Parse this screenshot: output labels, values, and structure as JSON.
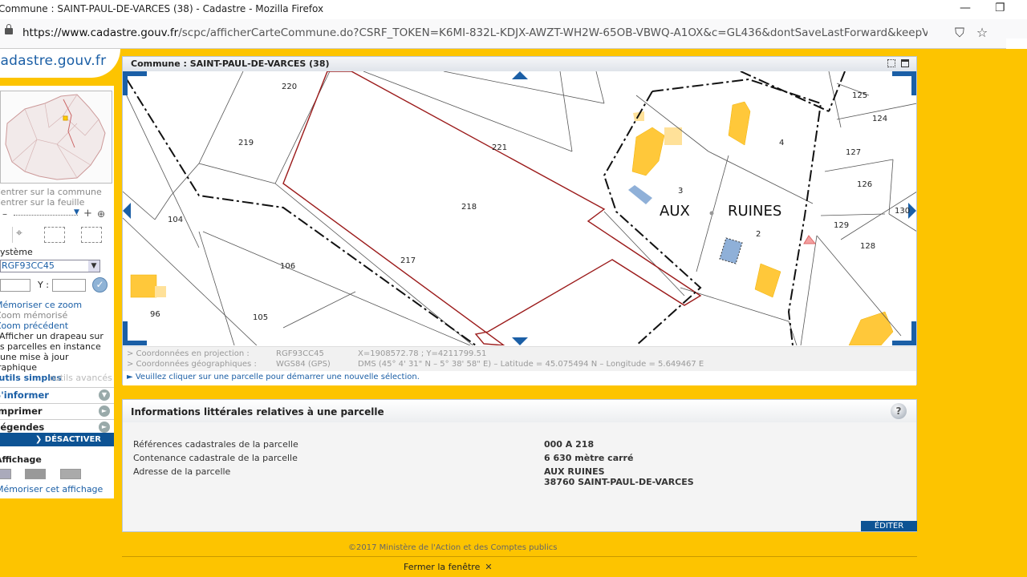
{
  "window": {
    "title": "Commune : SAINT-PAUL-DE-VARCES (38) - Cadastre - Mozilla Firefox",
    "minimize": "—",
    "restore": "❐"
  },
  "browser": {
    "url_domain": "https://www.cadastre.gouv.fr",
    "url_path": "/scpc/afficherCarteCommune.do?CSRF_TOKEN=K6MI-832L-KDJX-AWZT-WH2W-65OB-VBWQ-A1OX&c=GL436&dontSaveLastForward&keepVolatileSession=",
    "icons": [
      "pocket-icon",
      "bookmark-star-icon",
      "menu-icon"
    ]
  },
  "logo": {
    "text": "cadastre.gouv.fr"
  },
  "left_panel": {
    "center_commune": "Centrer sur la commune",
    "center_feuille": "Centrer sur la feuille",
    "systeme_label": "Système",
    "projection_value": "RGF93CC45",
    "y_label": "Y :",
    "ok_icon": "✓",
    "memo_zoom": "Mémoriser ce zoom",
    "zoom_memo": "Zoom mémorisé",
    "zoom_prev": "Zoom précédent",
    "flag_text": "Afficher un drapeau sur les parcelles en instance d'une mise à jour graphique",
    "tab_simple": "outils simples",
    "tab_advanced": "outils avancés",
    "tools": [
      "S'informer",
      "Imprimer",
      "Légendes"
    ],
    "deactivate": "DÉSACTIVER",
    "affichage_title": "Affichage",
    "memo_affichage": "Mémoriser cet affichage"
  },
  "map_panel": {
    "title": "Commune : SAINT-PAUL-DE-VARCES (38)",
    "parcels": [
      "220",
      "219",
      "221",
      "218",
      "104",
      "106",
      "217",
      "96",
      "105",
      "3",
      "4",
      "2",
      "125",
      "124",
      "127",
      "126",
      "130",
      "129",
      "128"
    ],
    "place_names": [
      "AUX",
      "RUINES"
    ],
    "coord_proj_label": "> Coordonnées en projection :",
    "coord_proj_system": "RGF93CC45",
    "coord_proj_value": "X=1908572.78 ; Y=4211799.51",
    "coord_geo_label": "> Coordonnées géographiques :",
    "coord_geo_system": "WGS84 (GPS)",
    "coord_geo_value": "DMS (45° 4' 31\" N – 5° 38' 58\" E) – Latitude = 45.075494 N – Longitude = 5.649467 E",
    "hint": "► Veuillez cliquer sur une parcelle pour démarrer une nouvelle sélection."
  },
  "info_panel": {
    "title": "Informations littérales relatives à une parcelle",
    "help_icon": "?",
    "rows": [
      {
        "label": "Références cadastrales de la parcelle",
        "value": "000 A 218"
      },
      {
        "label": "Contenance cadastrale de la parcelle",
        "value": "6 630 mètre carré"
      },
      {
        "label": "Adresse de la parcelle",
        "value": "AUX RUINES"
      }
    ],
    "address_line2": "38760 SAINT-PAUL-DE-VARCES",
    "edit": "ÉDITER"
  },
  "footer": {
    "copyright": "©2017 Ministère de l'Action et des Comptes publics",
    "close": "Fermer la fenêtre",
    "close_icon": "✕"
  }
}
